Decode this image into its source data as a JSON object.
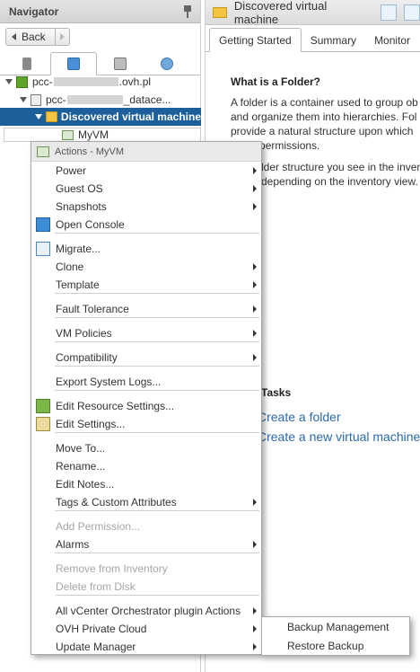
{
  "navigator": {
    "title": "Navigator",
    "back_label": "Back",
    "tree": {
      "root_prefix": "pcc-",
      "root_suffix": ".ovh.pl",
      "dc_prefix": "pcc-",
      "dc_suffix": "_datace...",
      "folder_label": "Discovered virtual machine",
      "vm_label": "MyVM"
    }
  },
  "content": {
    "title": "Discovered virtual machine",
    "tabs": [
      "Getting Started",
      "Summary",
      "Monitor"
    ],
    "heading": "What is a Folder?",
    "body_lines": [
      "A folder is a container used to group ob",
      "and organize them into hierarchies. Fol",
      "provide a natural structure upon which",
      "apply permissions."
    ],
    "body2_lines": [
      "lder structure you see in the inven",
      "depending on the inventory view."
    ],
    "tasks_heading": "Tasks",
    "task_links": [
      "Create a folder",
      "Create a new virtual machine"
    ]
  },
  "menu": {
    "header": "Actions - MyVM",
    "items": [
      {
        "label": "Power",
        "submenu": true,
        "disabled": false
      },
      {
        "label": "Guest OS",
        "submenu": true,
        "disabled": false
      },
      {
        "label": "Snapshots",
        "submenu": true,
        "disabled": false
      },
      {
        "label": "Open Console",
        "submenu": false,
        "disabled": false,
        "icon": "console-icon"
      },
      {
        "label": "Migrate...",
        "submenu": false,
        "disabled": false,
        "icon": "migrate-icon"
      },
      {
        "label": "Clone",
        "submenu": true,
        "disabled": false
      },
      {
        "label": "Template",
        "submenu": true,
        "disabled": false
      },
      {
        "label": "Fault Tolerance",
        "submenu": true,
        "disabled": false
      },
      {
        "label": "VM Policies",
        "submenu": true,
        "disabled": false
      },
      {
        "label": "Compatibility",
        "submenu": true,
        "disabled": false
      },
      {
        "label": "Export System Logs...",
        "submenu": false,
        "disabled": false
      },
      {
        "label": "Edit Resource Settings...",
        "submenu": false,
        "disabled": false,
        "icon": "resource-settings-icon"
      },
      {
        "label": "Edit Settings...",
        "submenu": false,
        "disabled": false,
        "icon": "edit-settings-icon"
      },
      {
        "label": "Move To...",
        "submenu": false,
        "disabled": false
      },
      {
        "label": "Rename...",
        "submenu": false,
        "disabled": false
      },
      {
        "label": "Edit Notes...",
        "submenu": false,
        "disabled": false
      },
      {
        "label": "Tags & Custom Attributes",
        "submenu": true,
        "disabled": false
      },
      {
        "label": "Add Permission...",
        "submenu": false,
        "disabled": true
      },
      {
        "label": "Alarms",
        "submenu": true,
        "disabled": false
      },
      {
        "label": "Remove from Inventory",
        "submenu": false,
        "disabled": true
      },
      {
        "label": "Delete from Disk",
        "submenu": false,
        "disabled": true
      },
      {
        "label": "All vCenter Orchestrator plugin Actions",
        "submenu": true,
        "disabled": false
      },
      {
        "label": "OVH Private Cloud",
        "submenu": true,
        "disabled": false
      },
      {
        "label": "Update Manager",
        "submenu": true,
        "disabled": false
      }
    ]
  },
  "submenu": {
    "items": [
      "Backup Management",
      "Restore Backup"
    ]
  },
  "colors": {
    "selection": "#1c5f9b",
    "link": "#2b6aa7",
    "disabled_text": "#a6a6a6"
  }
}
